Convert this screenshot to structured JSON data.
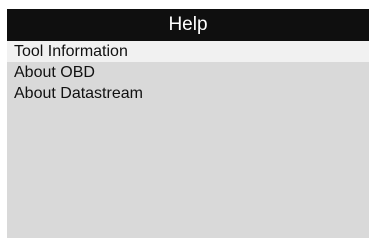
{
  "screen": {
    "title": "Help",
    "selected_index": 0,
    "menu_items": [
      {
        "label": "Tool Information"
      },
      {
        "label": "About OBD"
      },
      {
        "label": "About Datastream"
      }
    ]
  },
  "colors": {
    "title_background": "#0f0f0f",
    "title_text": "#ffffff",
    "screen_background": "#d9d9d9",
    "selected_background": "#f1f1f1",
    "item_text": "#111111"
  }
}
